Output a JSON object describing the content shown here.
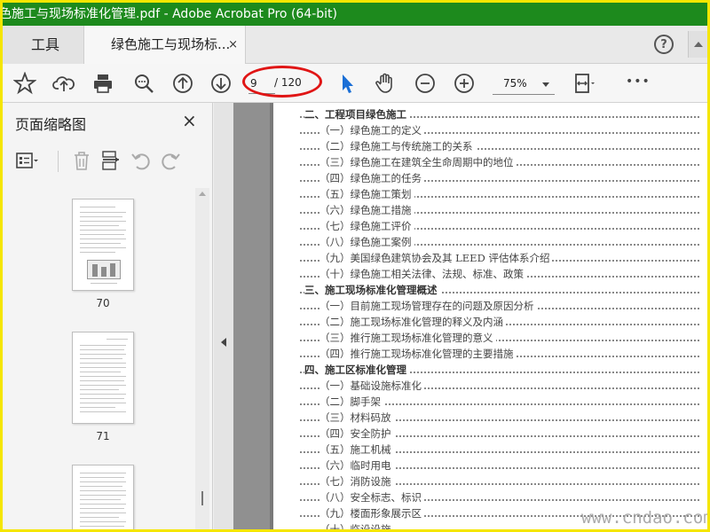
{
  "window": {
    "title": "色施工与现场标准化管理.pdf - Adobe Acrobat Pro (64-bit)"
  },
  "tabs": {
    "tools_label": "工具",
    "doc_label": "绿色施工与现场标...",
    "close_glyph": "×",
    "help_glyph": "?"
  },
  "toolbar": {
    "current_page": "9",
    "total_pages": "/ 120",
    "zoom": "75%",
    "more_glyph": "•••"
  },
  "panel": {
    "title": "页面缩略图",
    "close_glyph": "×",
    "thumbnails": [
      {
        "label": "70"
      },
      {
        "label": "71"
      }
    ]
  },
  "toc": [
    {
      "level": 1,
      "text": "二、工程项目绿色施工"
    },
    {
      "level": 2,
      "text": "（一）绿色施工的定义"
    },
    {
      "level": 2,
      "text": "（二）绿色施工与传统施工的关系"
    },
    {
      "level": 2,
      "text": "（三）绿色施工在建筑全生命周期中的地位"
    },
    {
      "level": 2,
      "text": "（四）绿色施工的任务"
    },
    {
      "level": 2,
      "text": "（五）绿色施工策划"
    },
    {
      "level": 2,
      "text": "（六）绿色施工措施"
    },
    {
      "level": 2,
      "text": "（七）绿色施工评价"
    },
    {
      "level": 2,
      "text": "（八）绿色施工案例"
    },
    {
      "level": 2,
      "text": "（九）美国绿色建筑协会及其 LEED 评估体系介绍"
    },
    {
      "level": 2,
      "text": "（十）绿色施工相关法律、法规、标准、政策"
    },
    {
      "level": 1,
      "text": "三、施工现场标准化管理概述"
    },
    {
      "level": 2,
      "text": "（一）目前施工现场管理存在的问题及原因分析"
    },
    {
      "level": 2,
      "text": "（二）施工现场标准化管理的释义及内涵"
    },
    {
      "level": 2,
      "text": "（三）推行施工现场标准化管理的意义"
    },
    {
      "level": 2,
      "text": "（四）推行施工现场标准化管理的主要措施"
    },
    {
      "level": 1,
      "text": "四、施工区标准化管理"
    },
    {
      "level": 2,
      "text": "（一）基础设施标准化"
    },
    {
      "level": 2,
      "text": "（二）脚手架"
    },
    {
      "level": 2,
      "text": "（三）材料码放"
    },
    {
      "level": 2,
      "text": "（四）安全防护"
    },
    {
      "level": 2,
      "text": "（五）施工机械"
    },
    {
      "level": 2,
      "text": "（六）临时用电"
    },
    {
      "level": 2,
      "text": "（七）消防设施"
    },
    {
      "level": 2,
      "text": "（八）安全标志、标识"
    },
    {
      "level": 2,
      "text": "（九）楼面形象展示区"
    },
    {
      "level": 2,
      "text": "（十）临设设施"
    }
  ],
  "watermark": "www.cndao.com",
  "colors": {
    "titlebar": "#1d8a1d",
    "border": "#f5e600",
    "annotation_oval": "#e01515",
    "select_tool": "#1a6fd6"
  }
}
